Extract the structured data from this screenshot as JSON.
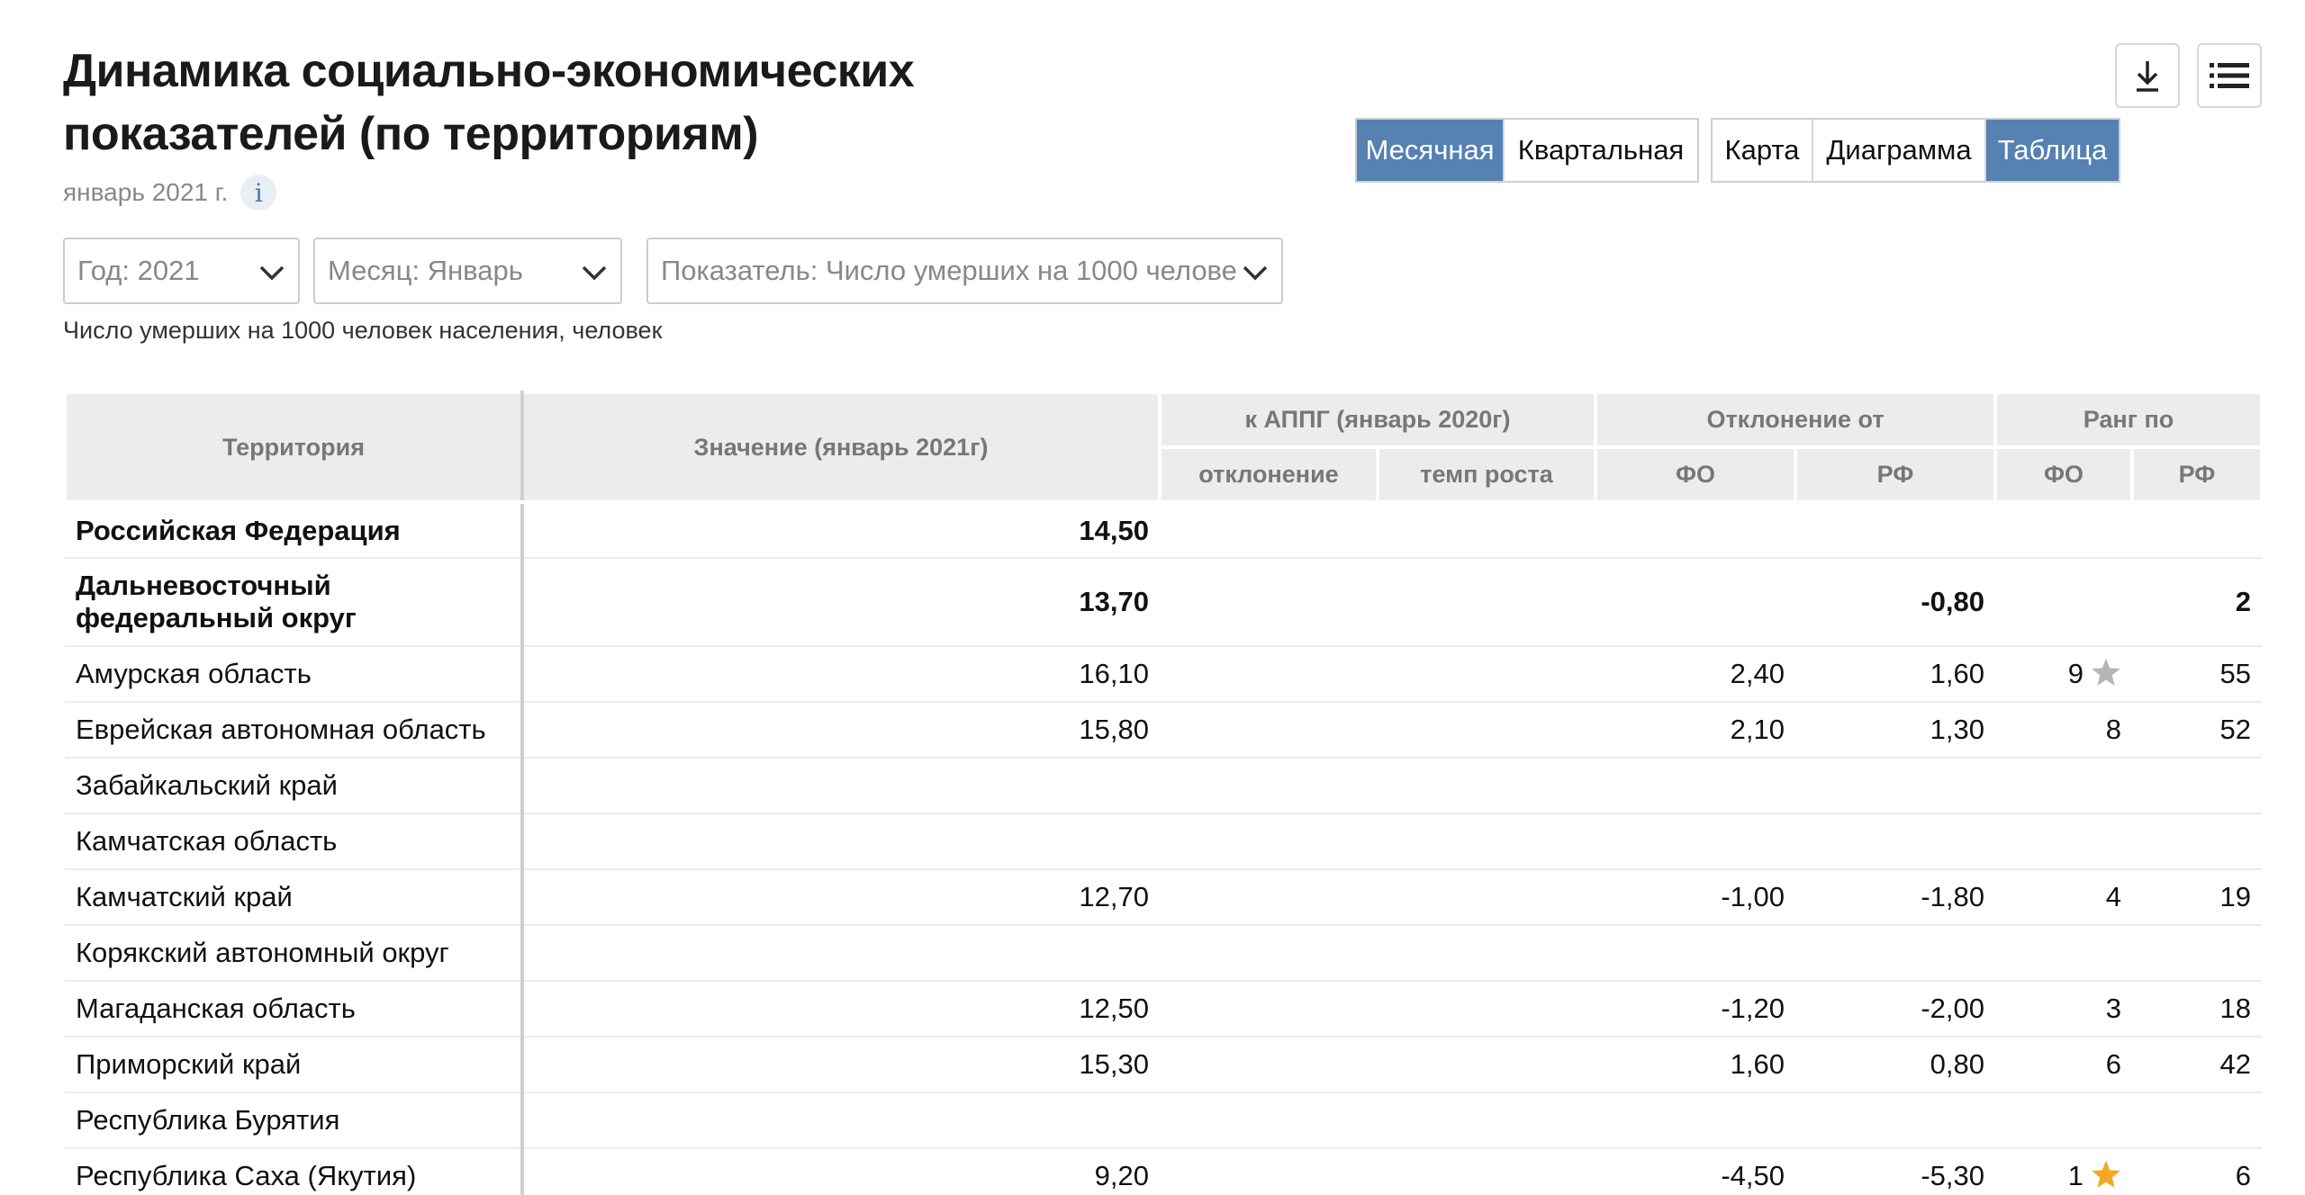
{
  "header": {
    "title_line1": "Динамика социально-экономических",
    "title_line2": "показателей (по территориям)",
    "period": "январь 2021 г.",
    "info_glyph": "i"
  },
  "toolbar": {
    "download_icon": "download-icon",
    "menu_icon": "list-icon"
  },
  "period_toggle": [
    {
      "label": "Месячная",
      "active": true
    },
    {
      "label": "Квартальная",
      "active": false
    }
  ],
  "view_toggle": [
    {
      "label": "Карта",
      "active": false
    },
    {
      "label": "Диаграмма",
      "active": false
    },
    {
      "label": "Таблица",
      "active": true
    }
  ],
  "filters": {
    "year": "Год: 2021",
    "month": "Месяц: Январь",
    "indicator": "Показатель: Число умерших на 1000 челове"
  },
  "unit_note": "Число умерших на 1000 человек населения, человек",
  "table": {
    "headers": {
      "territory": "Территория",
      "value": "Значение (январь 2021г)",
      "appg": "к АППГ (январь 2020г)",
      "deviation_from": "Отклонение от",
      "rank_by": "Ранг по",
      "appg_dev": "отклонение",
      "appg_rate": "темп роста",
      "fo": "ФО",
      "rf": "РФ",
      "rank_fo": "ФО",
      "rank_rf": "РФ"
    },
    "rows": [
      {
        "territory": "Российская Федерация",
        "value": "14,50",
        "appg_dev": "",
        "appg_rate": "",
        "dev_fo": "",
        "dev_rf": "",
        "rank_fo": "",
        "rank_rf": "",
        "star": "",
        "bold": true
      },
      {
        "territory": "Дальневосточный федеральный округ",
        "value": "13,70",
        "appg_dev": "",
        "appg_rate": "",
        "dev_fo": "",
        "dev_rf": "-0,80",
        "rank_fo": "",
        "rank_rf": "2",
        "star": "",
        "bold": true
      },
      {
        "territory": "Амурская область",
        "value": "16,10",
        "appg_dev": "",
        "appg_rate": "",
        "dev_fo": "2,40",
        "dev_rf": "1,60",
        "rank_fo": "9",
        "rank_rf": "55",
        "star": "grey"
      },
      {
        "territory": "Еврейская автономная область",
        "value": "15,80",
        "appg_dev": "",
        "appg_rate": "",
        "dev_fo": "2,10",
        "dev_rf": "1,30",
        "rank_fo": "8",
        "rank_rf": "52",
        "star": ""
      },
      {
        "territory": "Забайкальский край",
        "value": "",
        "appg_dev": "",
        "appg_rate": "",
        "dev_fo": "",
        "dev_rf": "",
        "rank_fo": "",
        "rank_rf": "",
        "star": ""
      },
      {
        "territory": "Камчатская область",
        "value": "",
        "appg_dev": "",
        "appg_rate": "",
        "dev_fo": "",
        "dev_rf": "",
        "rank_fo": "",
        "rank_rf": "",
        "star": ""
      },
      {
        "territory": "Камчатский край",
        "value": "12,70",
        "appg_dev": "",
        "appg_rate": "",
        "dev_fo": "-1,00",
        "dev_rf": "-1,80",
        "rank_fo": "4",
        "rank_rf": "19",
        "star": ""
      },
      {
        "territory": "Корякский автономный округ",
        "value": "",
        "appg_dev": "",
        "appg_rate": "",
        "dev_fo": "",
        "dev_rf": "",
        "rank_fo": "",
        "rank_rf": "",
        "star": ""
      },
      {
        "territory": "Магаданская область",
        "value": "12,50",
        "appg_dev": "",
        "appg_rate": "",
        "dev_fo": "-1,20",
        "dev_rf": "-2,00",
        "rank_fo": "3",
        "rank_rf": "18",
        "star": ""
      },
      {
        "territory": "Приморский край",
        "value": "15,30",
        "appg_dev": "",
        "appg_rate": "",
        "dev_fo": "1,60",
        "dev_rf": "0,80",
        "rank_fo": "6",
        "rank_rf": "42",
        "star": ""
      },
      {
        "territory": "Республика Бурятия",
        "value": "",
        "appg_dev": "",
        "appg_rate": "",
        "dev_fo": "",
        "dev_rf": "",
        "rank_fo": "",
        "rank_rf": "",
        "star": ""
      },
      {
        "territory": "Республика Саха (Якутия)",
        "value": "9,20",
        "appg_dev": "",
        "appg_rate": "",
        "dev_fo": "-4,50",
        "dev_rf": "-5,30",
        "rank_fo": "1",
        "rank_rf": "6",
        "star": "gold"
      }
    ]
  },
  "colors": {
    "accent": "#5581b3",
    "star_gold": "#f5a623",
    "star_grey": "#b5b5b5"
  }
}
